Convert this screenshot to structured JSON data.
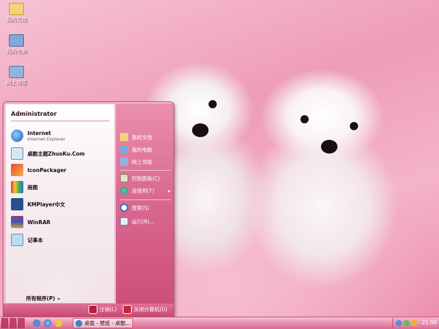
{
  "desktop": {
    "icons": [
      {
        "label": "我的文档",
        "icon": "folder-icon"
      },
      {
        "label": "我的电脑",
        "icon": "computer-icon"
      },
      {
        "label": "网上邻居",
        "icon": "network-icon"
      }
    ]
  },
  "start_menu": {
    "user": "Administrator",
    "pinned": [
      {
        "title": "Internet",
        "subtitle": "Internet Explorer",
        "icon": "internet-explorer-icon"
      },
      {
        "title": "桌酷主题ZhuoKu.Com",
        "icon": "zhuoku-icon"
      },
      {
        "title": "IconPackager",
        "icon": "iconpackager-icon"
      },
      {
        "title": "画图",
        "icon": "paint-icon"
      },
      {
        "title": "KMPlayer中文",
        "icon": "kmplayer-icon"
      },
      {
        "title": "WinRAR",
        "icon": "winrar-icon"
      },
      {
        "title": "记事本",
        "icon": "notepad-icon"
      }
    ],
    "all_programs": "所有程序(P)",
    "right": [
      {
        "label": "我的文档",
        "icon": "folder-icon"
      },
      {
        "label": "我的电脑",
        "icon": "computer-icon"
      },
      {
        "label": "网上邻居",
        "icon": "network-icon"
      },
      {
        "label": "控制面板(C)",
        "icon": "control-panel-icon"
      },
      {
        "label": "连接到(T)",
        "icon": "connect-icon"
      },
      {
        "label": "搜索(S)",
        "icon": "search-icon"
      },
      {
        "label": "运行(R)...",
        "icon": "run-icon"
      }
    ],
    "logoff": "注销(L)",
    "shutdown": "关闭计算机(U)"
  },
  "taskbar": {
    "task": "桌面 - 壁纸 - 桌酷...",
    "clock": "21:00"
  },
  "colors": {
    "menu_right": "#da6a92",
    "taskbar": "#e892b1",
    "accent": "#c24a74"
  }
}
